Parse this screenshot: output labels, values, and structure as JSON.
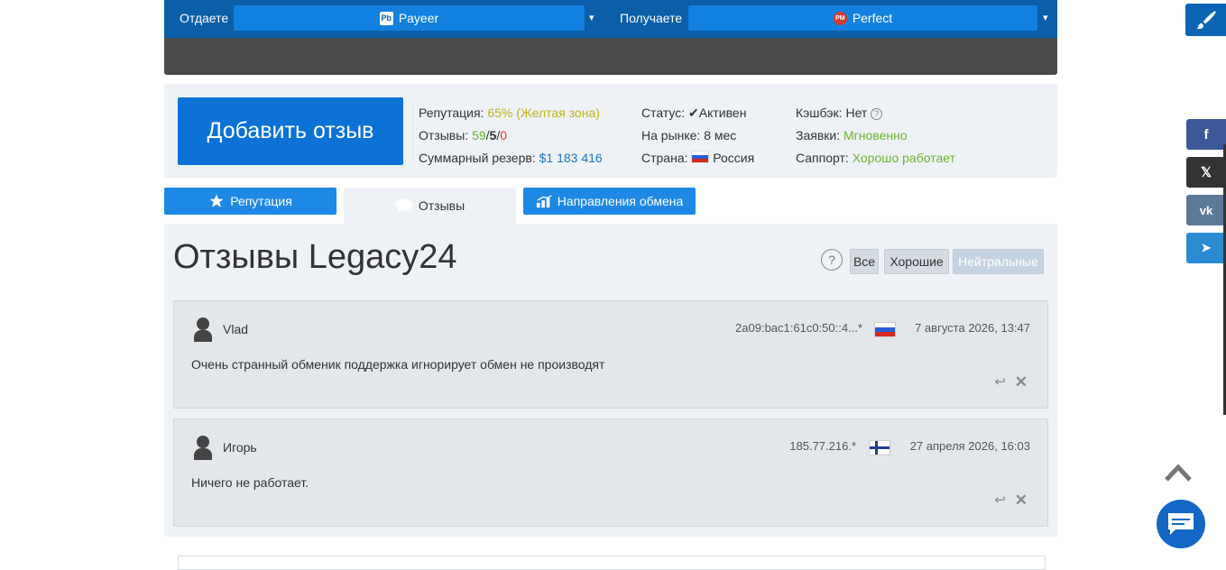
{
  "exchange": {
    "give_label": "Отдаете",
    "give_value": "Payeer",
    "give_icon_text": "Pb",
    "get_label": "Получаете",
    "get_value": "Perfect",
    "get_icon_text": "PM",
    "arrow": "▾"
  },
  "info": {
    "add_review_label": "Добавить отзыв",
    "reputation_label": "Репутация:",
    "reputation_value": "65% (Желтая зона)",
    "reviews_label": "Отзывы:",
    "reviews_good": "59",
    "reviews_neutral": "5",
    "reviews_bad": "0",
    "reviews_sep": "/",
    "reserve_label": "Суммарный резерв:",
    "reserve_value": "$1 183 416",
    "status_label": "Статус:",
    "status_value": "✔Активен",
    "market_label": "На рынке:",
    "market_value": "8 мес",
    "country_label": "Страна:",
    "country_value": "Россия",
    "cashback_label": "Кэшбэк:",
    "cashback_value": "Нет",
    "requests_label": "Заявки:",
    "requests_value": "Мгновенно",
    "support_label": "Саппорт:",
    "support_value": "Хорошо работает",
    "help_glyph": "?"
  },
  "tabs": {
    "reputation": "Репутация",
    "reviews": "Отзывы",
    "directions": "Направления обмена"
  },
  "reviews_section": {
    "title": "Отзывы Legacy24",
    "help_glyph": "?",
    "filter_all": "Все",
    "filter_good": "Хорошие",
    "filter_neutral": "Нейтральные"
  },
  "reviews": [
    {
      "name": "Vlad",
      "ip": "2a09:bac1:61c0:50::4...*",
      "flag": "ru",
      "date": "7 августа 2026, 13:47",
      "text": "Очень странный обменик поддержка игнорирует обмен не производят"
    },
    {
      "name": "Игорь",
      "ip": "185.77.216.*",
      "flag": "fi",
      "date": "27 апреля 2026, 16:03",
      "text": "Ничего не работает."
    }
  ],
  "review_actions": {
    "reply_glyph": "↩",
    "delete_glyph": "✕"
  },
  "social": {
    "facebook": "f",
    "x": "𝕏",
    "vk": "vk",
    "telegram": "➤"
  },
  "colors": {
    "topbar": "#0a5fa8",
    "primary_button": "#0d72d6",
    "tab_blue": "#1e88e5",
    "reputation_yellow": "#c2b21a",
    "positive_green": "#6cb52d",
    "negative_red": "#e53935"
  },
  "icons": {
    "tab_reputation": "star-icon",
    "tab_reviews": "speech-bubble-icon",
    "tab_directions": "bar-chart-icon",
    "paint": "brush-icon",
    "chat": "chat-icon",
    "scroll_top": "chevron-up-icon"
  }
}
